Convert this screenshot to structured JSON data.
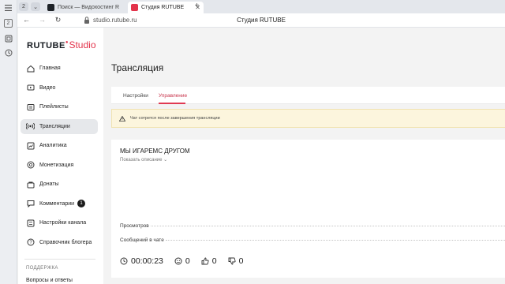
{
  "browser": {
    "tab_count": "2",
    "tabs": [
      {
        "title": "Поиск — Видохостинг R",
        "favicon_color": "#1f2328"
      },
      {
        "title": "Студия RUTUBE",
        "favicon_color": "#e3334b"
      }
    ],
    "new_tab": "+",
    "url": "studio.rutube.ru",
    "page_title": "Студия RUTUBE",
    "side_badge": "2"
  },
  "logo": {
    "text": "RUTUBE",
    "suffix": "Studio"
  },
  "sidebar": {
    "items": [
      {
        "label": "Главная",
        "icon": "home-icon"
      },
      {
        "label": "Видео",
        "icon": "video-icon"
      },
      {
        "label": "Плейлисты",
        "icon": "playlist-icon"
      },
      {
        "label": "Трансляции",
        "icon": "broadcast-icon",
        "active": true
      },
      {
        "label": "Аналитика",
        "icon": "analytics-icon"
      },
      {
        "label": "Монетизация",
        "icon": "monetization-icon"
      },
      {
        "label": "Донаты",
        "icon": "donate-icon"
      },
      {
        "label": "Комментарии",
        "icon": "comments-icon",
        "badge": "1"
      },
      {
        "label": "Настройки канала",
        "icon": "settings-icon"
      },
      {
        "label": "Справочник блогера",
        "icon": "help-icon"
      }
    ],
    "support_title": "ПОДДЕРЖКА",
    "support_item": "Вопросы и ответы"
  },
  "main": {
    "title": "Трансляция",
    "tabs": [
      {
        "label": "Настройки"
      },
      {
        "label": "Управление",
        "active": true
      }
    ],
    "warning": "Чат сотрется после завершения трансляции",
    "stream": {
      "title": "МЫ ИГАРЕМС ДРУГОМ",
      "show_description": "Показать описание",
      "stats": [
        {
          "label": "Просмотров"
        },
        {
          "label": "Сообщений в чате"
        }
      ],
      "bottom": {
        "duration": "00:00:23",
        "viewers": "0",
        "likes": "0",
        "dislikes": "0"
      }
    }
  },
  "colors": {
    "accent": "#e3334b",
    "warning_bg": "#fcf5dd",
    "active_item_bg": "#e6e8eb"
  }
}
